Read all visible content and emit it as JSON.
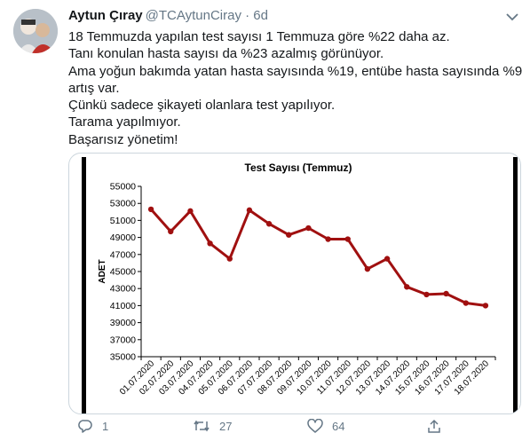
{
  "tweet": {
    "author_name": "Aytun Çıray",
    "handle_time": "@TCAytunCiray · 6d",
    "lines": [
      "18 Temmuzda yapılan test sayısı 1 Temmuza göre %22 daha az.",
      "Tanı konulan hasta sayısı da %23 azalmış görünüyor.",
      "Ama yoğun bakımda yatan hasta sayısında %19, entübe hasta sayısında %9",
      "artış var.",
      "Çünkü sadece şikayeti olanlara test yapılıyor.",
      "Tarama yapılmıyor.",
      "Başarısız yönetim!"
    ]
  },
  "actions": {
    "reply_count": "1",
    "retweet_count": "27",
    "like_count": "64"
  },
  "icons": [
    "avatar",
    "chevron-down-icon",
    "reply-icon",
    "retweet-icon",
    "like-icon",
    "share-icon"
  ],
  "chart_data": {
    "type": "line",
    "title": "Test Sayısı (Temmuz)",
    "ylabel": "ADET",
    "xlabel": "",
    "categories": [
      "01.07.2020",
      "02.07.2020",
      "03.07.2020",
      "04.07.2020",
      "05.07.2020",
      "06.07.2020",
      "07.07.2020",
      "08.07.2020",
      "09.07.2020",
      "10.07.2020",
      "11.07.2020",
      "12.07.2020",
      "13.07.2020",
      "14.07.2020",
      "15.07.2020",
      "16.07.2020",
      "17.07.2020",
      "18.07.2020"
    ],
    "values": [
      52300,
      49700,
      52100,
      48300,
      46500,
      52200,
      50600,
      49300,
      50100,
      48800,
      48800,
      45300,
      46500,
      43200,
      42300,
      42400,
      41300,
      41000
    ],
    "yticks": [
      "35000",
      "37000",
      "39000",
      "41000",
      "43000",
      "45000",
      "47000",
      "49000",
      "51000",
      "53000",
      "55000"
    ],
    "ylim": [
      35000,
      55000
    ],
    "color": "#a01010",
    "grid": false,
    "legend": false
  }
}
